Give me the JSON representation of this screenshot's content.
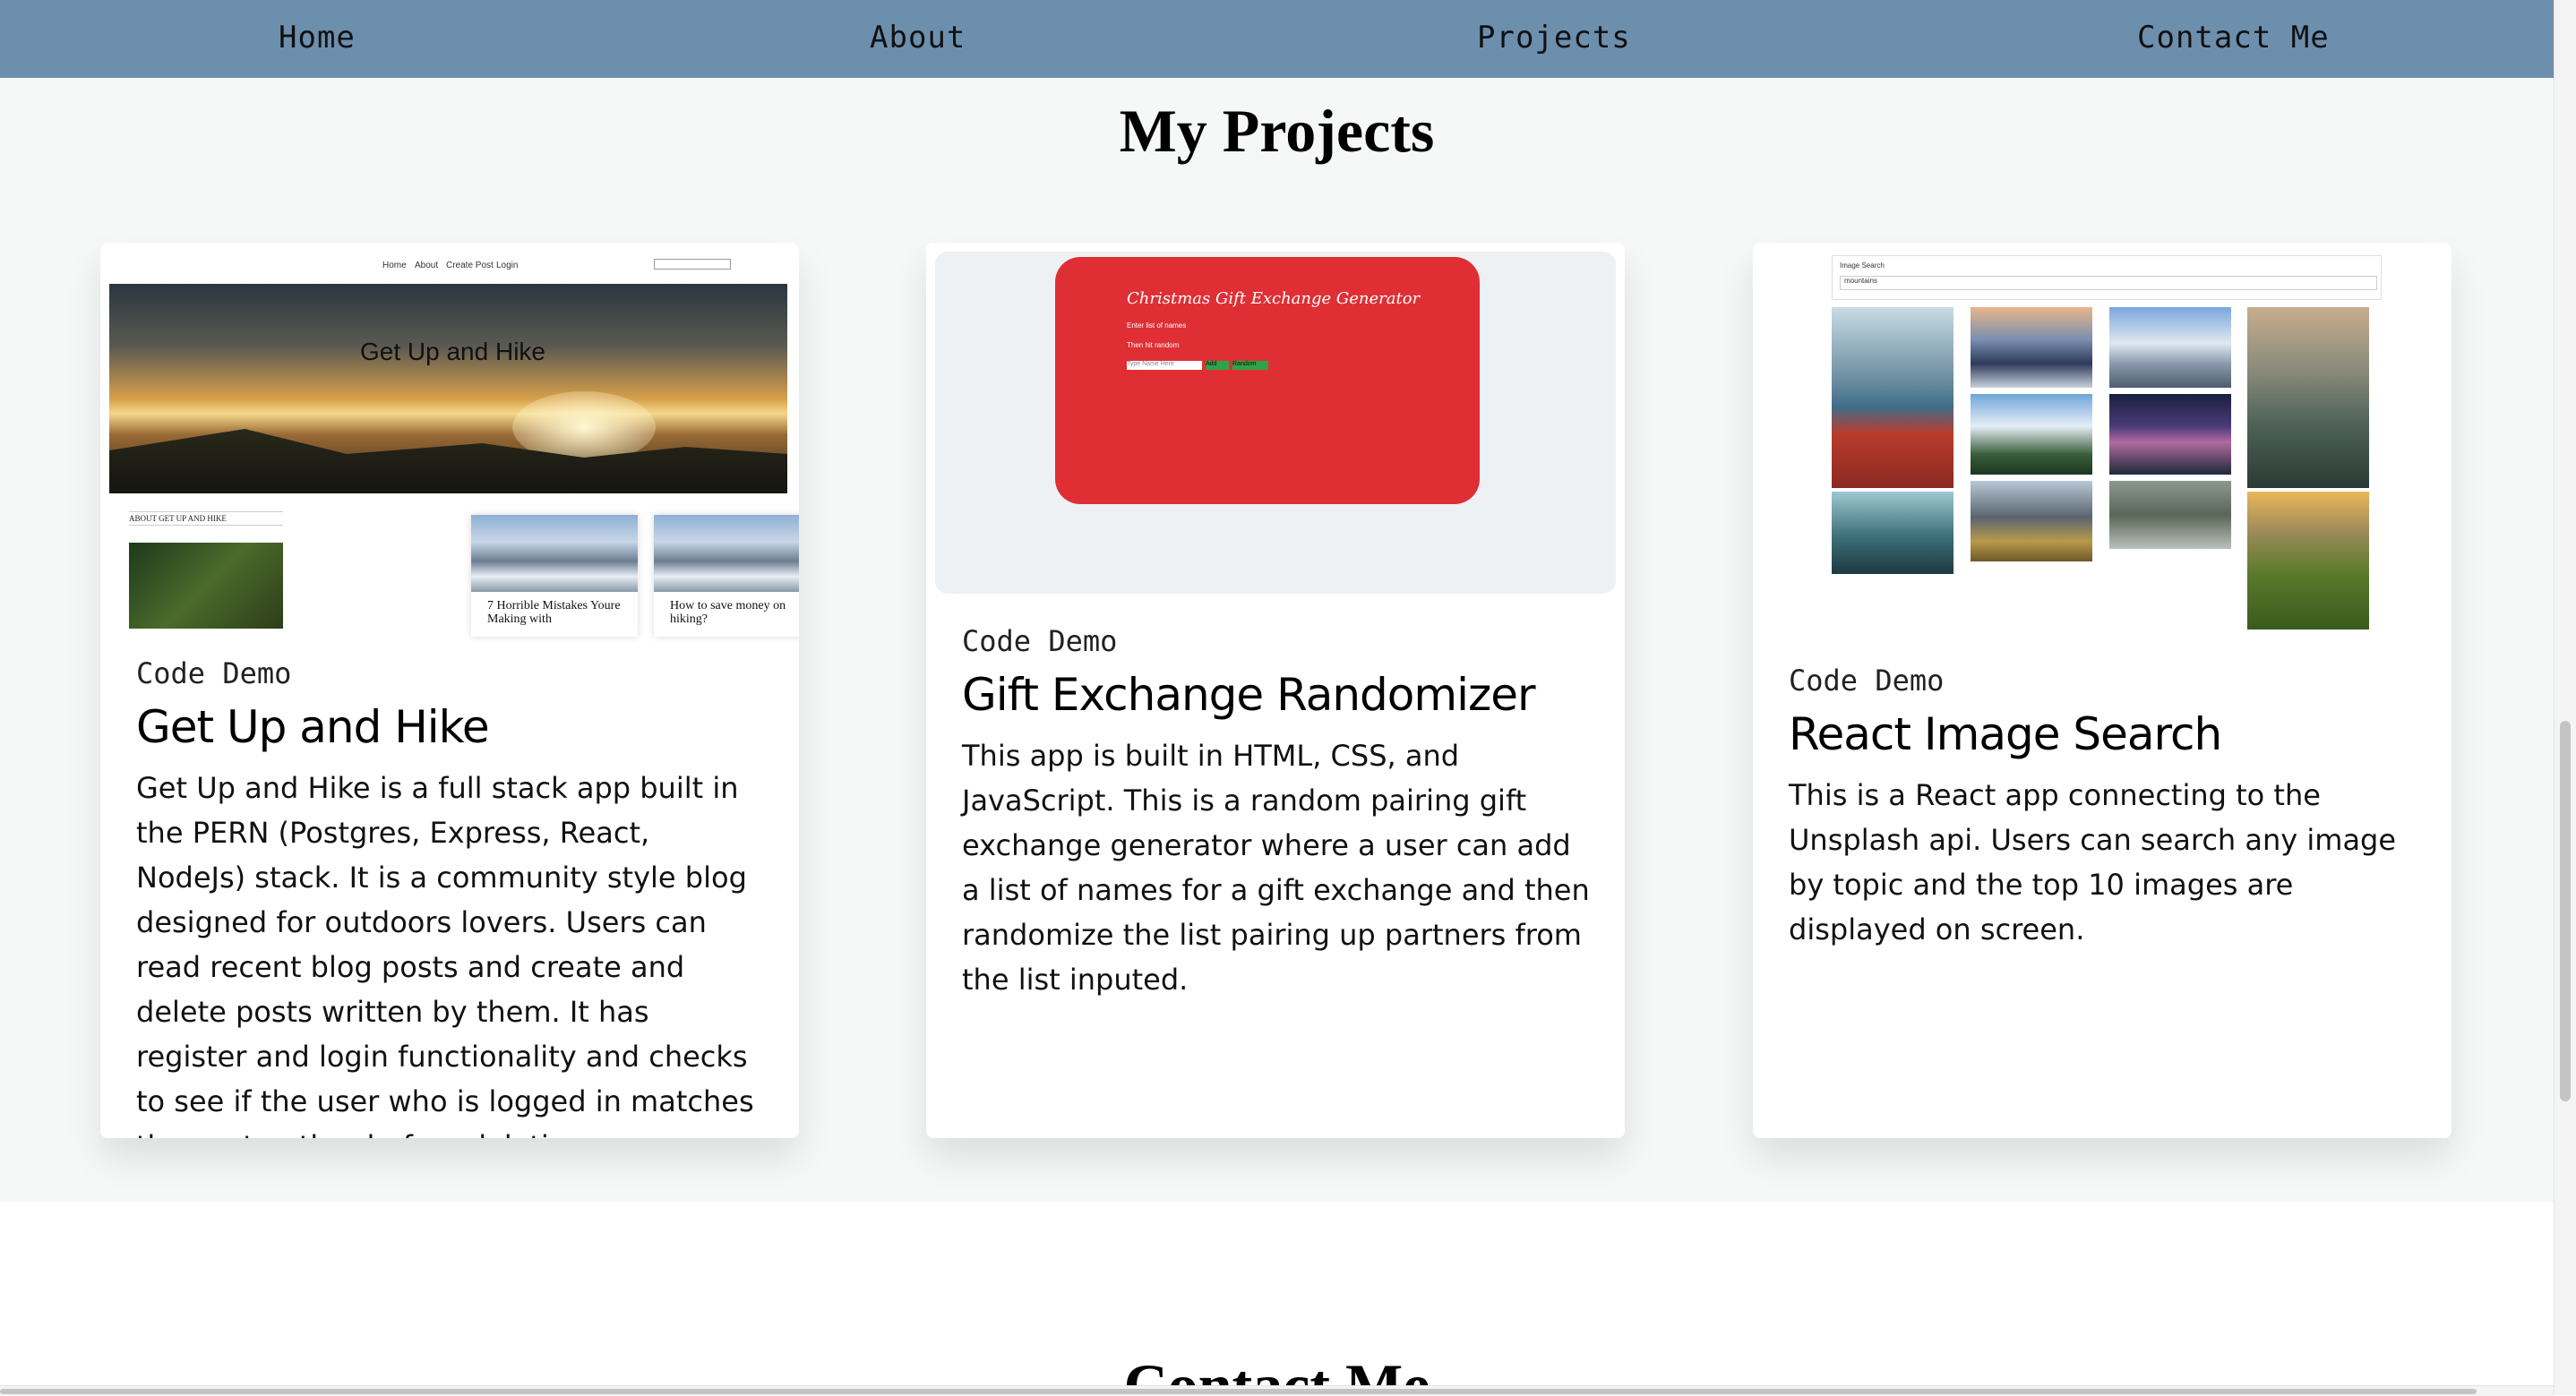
{
  "nav": {
    "items": [
      "Home",
      "About",
      "Projects",
      "Contact Me"
    ]
  },
  "projects": {
    "title": "My Projects",
    "cards": [
      {
        "tag": "Code Demo",
        "title": "Get Up and Hike",
        "description": "Get Up and Hike is a full stack app built in the PERN (Postgres, Express, React, NodeJs) stack. It is a community style blog designed for outdoors lovers. Users can read recent blog posts and create and delete posts written by them. It has register and login functionality and checks to see if the user who is logged in matches the post author before deleting.",
        "preview": {
          "nav": [
            "Home",
            "About",
            "Create Post",
            "Login"
          ],
          "hero_title": "Get Up and Hike",
          "about_heading": "ABOUT GET UP AND HIKE",
          "posts": [
            "7 Horrible Mistakes Youre Making with",
            "How to save money on hiking?"
          ]
        }
      },
      {
        "tag": "Code Demo",
        "title": "Gift Exchange Randomizer",
        "description": "This app is built in HTML, CSS, and JavaScript. This is a random pairing gift exchange generator where a user can add a list of names for a gift exchange and then randomize the list pairing up partners from the list inputed.",
        "preview": {
          "heading": "Christmas Gift Exchange Generator",
          "line1": "Enter list of names",
          "line2": "Then hit random",
          "input_placeholder": "Type Name Here",
          "add_label": "Add",
          "random_label": "Random"
        }
      },
      {
        "tag": "Code Demo",
        "title": "React Image Search",
        "description": "This is a React app connecting to the Unsplash api. Users can search any image by topic and the top 10 images are displayed on screen.",
        "preview": {
          "label": "Image Search",
          "query": "mountains"
        }
      }
    ]
  },
  "contact": {
    "title": "Contact Me"
  }
}
